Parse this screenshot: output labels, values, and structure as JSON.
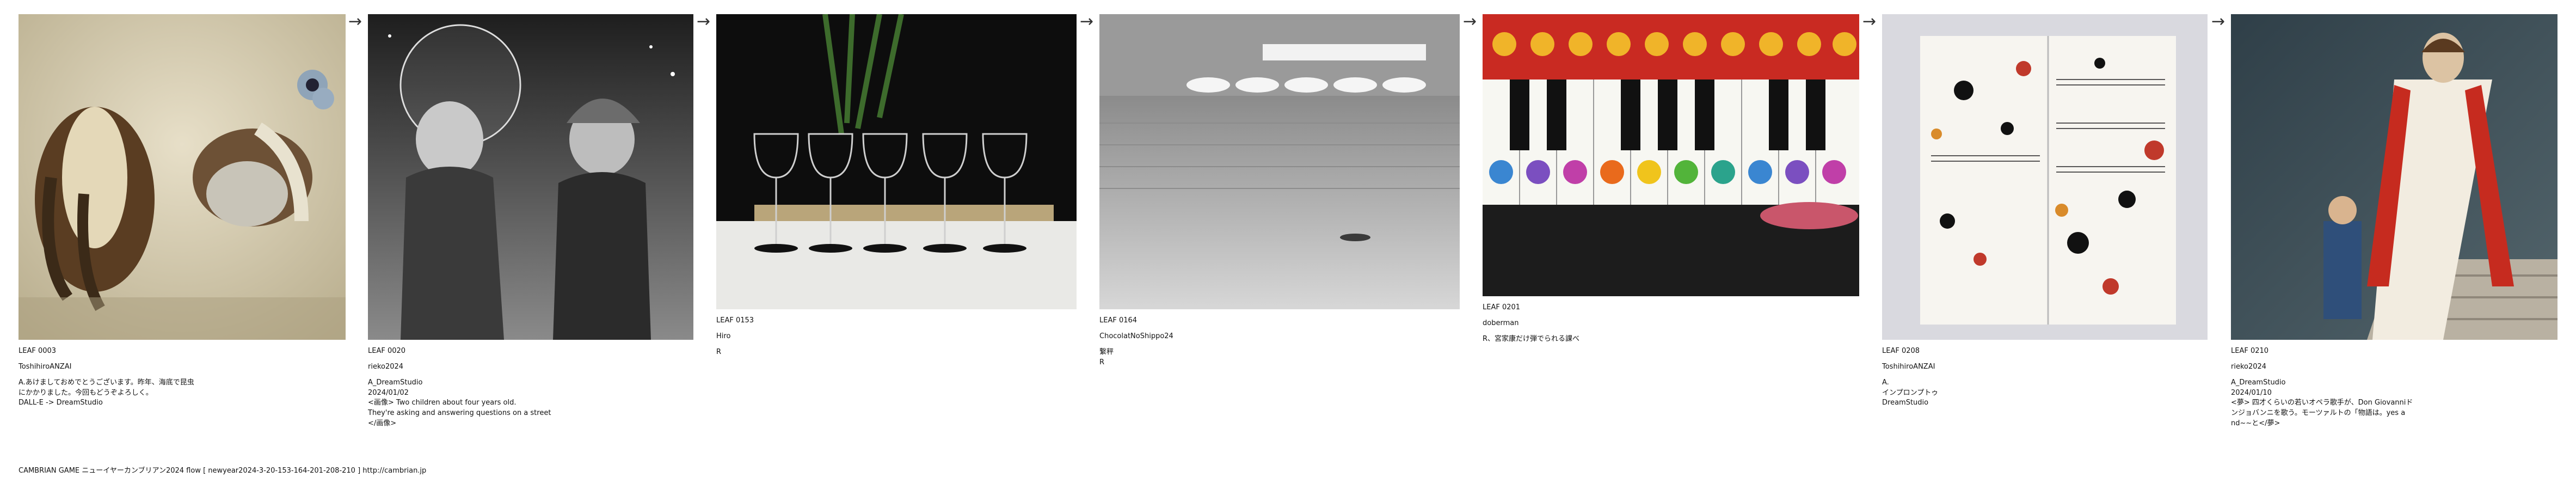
{
  "arrow_glyph": "→",
  "leaves": [
    {
      "id": "LEAF 0003",
      "author": "ToshihiroANZAI",
      "lines": [
        "A.あけましておめでとうございます。昨年、海底で昆虫",
        "にかかりました。今回もどうぞよろしく。",
        "DALL-E -> DreamStudio"
      ]
    },
    {
      "id": "LEAF 0020",
      "author": "rieko2024",
      "lines": [
        "A_DreamStudio",
        "2024/01/02",
        "<画像> Two children about four years old.",
        "They're asking and answering questions on a street",
        "</画像>"
      ]
    },
    {
      "id": "LEAF 0153",
      "author": "Hiro",
      "lines": [
        "R"
      ]
    },
    {
      "id": "LEAF 0164",
      "author": "ChocolatNoShippo24",
      "lines": [
        "繋秤",
        "R"
      ]
    },
    {
      "id": "LEAF 0201",
      "author": "doberman",
      "lines": [
        "R、宮家康だけ弾でられる課べ"
      ]
    },
    {
      "id": "LEAF 0208",
      "author": "ToshihiroANZAI",
      "lines": [
        "A.",
        "インプロンプトゥ",
        "DreamStudio"
      ]
    },
    {
      "id": "LEAF 0210",
      "author": "rieko2024",
      "lines": [
        "A_DreamStudio",
        "2024/01/10",
        "<夢> 四才くらいの若いオペラ歌手が、Don Giovanniド",
        "ンジョバンニを歌う。モーツァルトの「物語は。yes a",
        "nd~~と</夢>"
      ]
    }
  ],
  "footer": "CAMBRIAN GAME  ニューイヤーカンブリアン2024  flow [ newyear2024-3-20-153-164-201-208-210 ]   http://cambrian.jp"
}
